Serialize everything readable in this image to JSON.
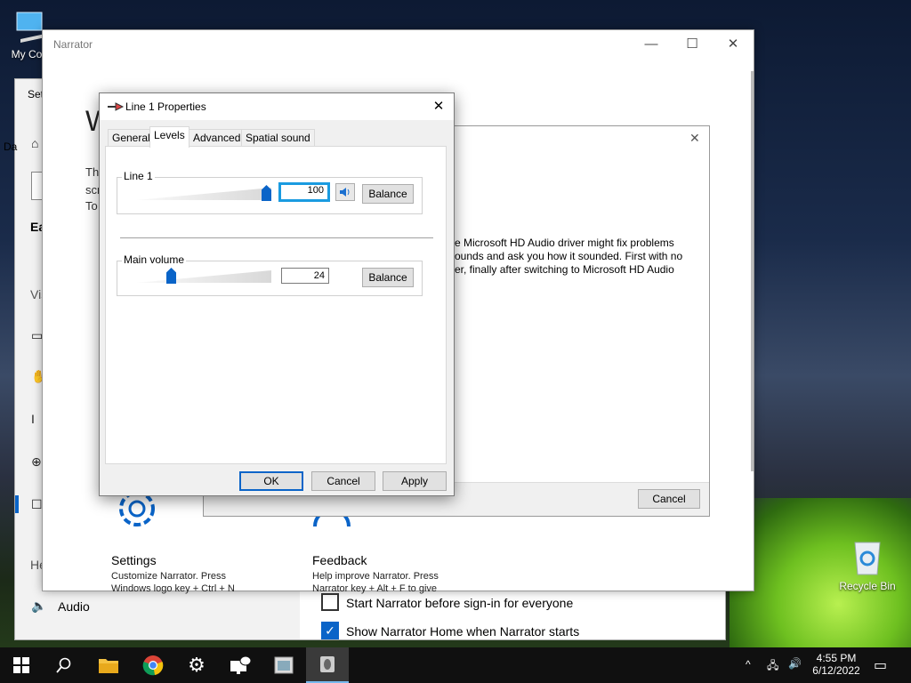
{
  "desktop": {
    "my_computer_label": "My Com",
    "recycle_bin_label": "Recycle Bin"
  },
  "settings_window": {
    "title_partial": "Set",
    "fragment_da": "Da",
    "fragment_ea": "Ea",
    "fragment_vis": "Vis",
    "fragment_he": "He",
    "audio_label": "Audio",
    "checkbox_start_label": "Start Narrator before sign-in for everyone",
    "checkbox_start_checked": false,
    "checkbox_home_label": "Show Narrator Home when Narrator starts",
    "checkbox_home_checked": true
  },
  "narrator_window": {
    "title": "Narrator",
    "heading_partial": "W",
    "text_fragments": [
      "Th",
      "scr",
      "To"
    ],
    "settings_title": "Settings",
    "settings_desc_1": "Customize Narrator. Press",
    "settings_desc_2": "Windows logo key + Ctrl + N",
    "feedback_title": "Feedback",
    "feedback_desc_1": "Help improve Narrator. Press",
    "feedback_desc_2": "Narrator key + Alt + F to give"
  },
  "inner_dialog": {
    "text_line_1": "e Microsoft HD Audio driver might fix problems",
    "text_line_2": "ounds and ask you how it sounded. First with no",
    "text_line_3": "er, finally after switching to Microsoft HD Audio",
    "cancel_label": "Cancel"
  },
  "properties_dialog": {
    "title": "Line 1 Properties",
    "tabs": [
      {
        "label": "General",
        "active": false
      },
      {
        "label": "Levels",
        "active": true
      },
      {
        "label": "Advanced",
        "active": false
      },
      {
        "label": "Spatial sound",
        "active": false
      }
    ],
    "line1": {
      "label": "Line 1",
      "value": "100",
      "level": 100,
      "balance_label": "Balance"
    },
    "main_volume": {
      "label": "Main volume",
      "value": "24",
      "level": 24,
      "balance_label": "Balance"
    },
    "ok_label": "OK",
    "cancel_label": "Cancel",
    "apply_label": "Apply"
  },
  "taskbar": {
    "time": "4:55 PM",
    "date": "6/12/2022"
  },
  "colors": {
    "accent": "#0a64c8",
    "focus": "#1a9be0",
    "taskbar": "#101010"
  }
}
